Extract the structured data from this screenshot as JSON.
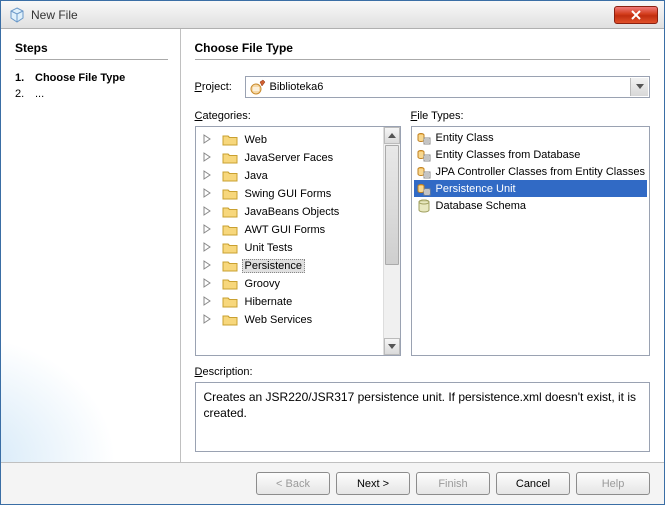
{
  "window": {
    "title": "New File"
  },
  "left": {
    "header": "Steps",
    "steps": [
      {
        "num": "1.",
        "label": "Choose File Type",
        "bold": true
      },
      {
        "num": "2.",
        "label": "...",
        "bold": false
      }
    ]
  },
  "right": {
    "header": "Choose File Type",
    "project_label": "Project:",
    "project_value": "Biblioteka6",
    "categories_label": "Categories:",
    "filetypes_label": "File Types:",
    "categories": [
      "Web",
      "JavaServer Faces",
      "Java",
      "Swing GUI Forms",
      "JavaBeans Objects",
      "AWT GUI Forms",
      "Unit Tests",
      "Persistence",
      "Groovy",
      "Hibernate",
      "Web Services"
    ],
    "categories_selected": "Persistence",
    "filetypes": [
      "Entity Class",
      "Entity Classes from Database",
      "JPA Controller Classes from Entity Classes",
      "Persistence Unit",
      "Database Schema"
    ],
    "filetypes_selected": "Persistence Unit",
    "description_label": "Description:",
    "description": "Creates an JSR220/JSR317 persistence unit. If persistence.xml doesn't exist, it is created."
  },
  "buttons": {
    "back": "< Back",
    "next": "Next >",
    "finish": "Finish",
    "cancel": "Cancel",
    "help": "Help"
  }
}
